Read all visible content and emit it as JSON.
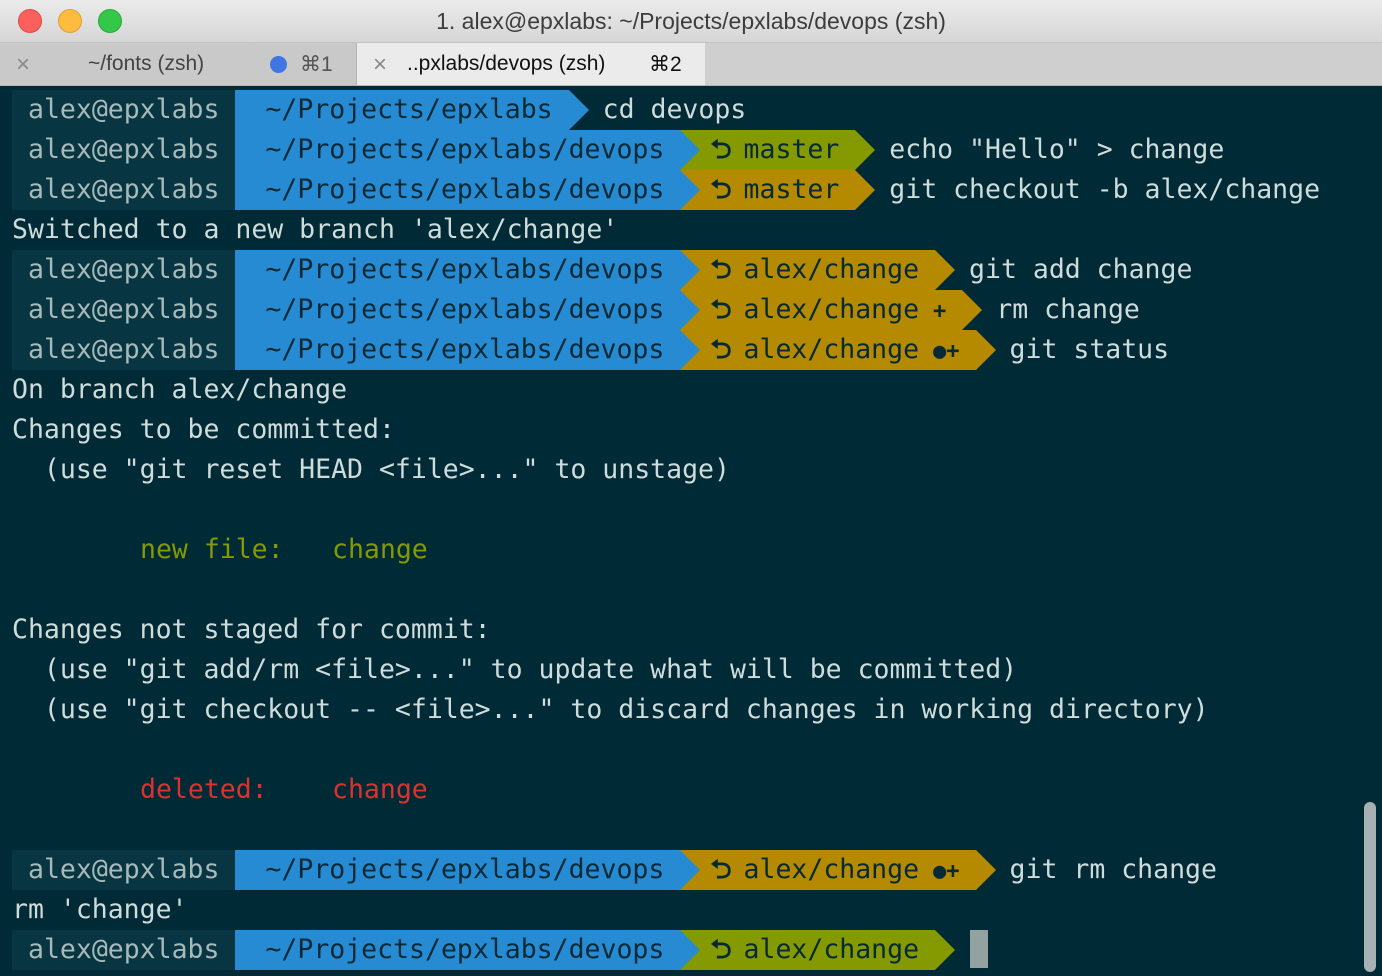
{
  "window": {
    "title": "1. alex@epxlabs: ~/Projects/epxlabs/devops (zsh)"
  },
  "tabs": [
    {
      "label": "~/fonts (zsh)",
      "shortcut": "⌘1",
      "close": "×",
      "active": false
    },
    {
      "label": "..pxlabs/devops (zsh)",
      "shortcut": "⌘2",
      "close": "×",
      "active": true
    }
  ],
  "colors": {
    "background": "#002a35",
    "user_segment": "#073642",
    "dir_segment": "#268bd2",
    "git_clean": "#859900",
    "git_dirty": "#b58900",
    "staged_text": "#859900",
    "deleted_text": "#dc322f"
  },
  "terminal": {
    "prompts": [
      {
        "user": "alex@epxlabs",
        "dir": "~/Projects/epxlabs",
        "branch": "",
        "status": "",
        "command": "cd devops"
      },
      {
        "user": "alex@epxlabs",
        "dir": "~/Projects/epxlabs/devops",
        "branch": "master",
        "status": "",
        "command": "echo \"Hello\" > change"
      },
      {
        "user": "alex@epxlabs",
        "dir": "~/Projects/epxlabs/devops",
        "branch": "master",
        "status": "",
        "command": "git checkout -b alex/change"
      },
      {
        "user": "alex@epxlabs",
        "dir": "~/Projects/epxlabs/devops",
        "branch": "alex/change",
        "status": "",
        "command": "git add change"
      },
      {
        "user": "alex@epxlabs",
        "dir": "~/Projects/epxlabs/devops",
        "branch": "alex/change",
        "status": "+",
        "command": "rm change"
      },
      {
        "user": "alex@epxlabs",
        "dir": "~/Projects/epxlabs/devops",
        "branch": "alex/change",
        "status": "●+",
        "command": "git status"
      },
      {
        "user": "alex@epxlabs",
        "dir": "~/Projects/epxlabs/devops",
        "branch": "alex/change",
        "status": "●+",
        "command": "git rm change"
      },
      {
        "user": "alex@epxlabs",
        "dir": "~/Projects/epxlabs/devops",
        "branch": "alex/change",
        "status": "",
        "command": ""
      }
    ],
    "output": {
      "switched": "Switched to a new branch 'alex/change'",
      "on_branch": "On branch alex/change",
      "to_be_committed": "Changes to be committed:",
      "unstage_hint": "  (use \"git reset HEAD <file>...\" to unstage)",
      "new_file_label": "new file:",
      "new_file_name": "change",
      "not_staged": "Changes not staged for commit:",
      "add_rm_hint": "  (use \"git add/rm <file>...\" to update what will be committed)",
      "checkout_hint": "  (use \"git checkout -- <file>...\" to discard changes in working directory)",
      "deleted_label": "deleted:",
      "deleted_name": "change",
      "rm_output": "rm 'change'"
    },
    "git_icon": "git-branch-icon"
  }
}
